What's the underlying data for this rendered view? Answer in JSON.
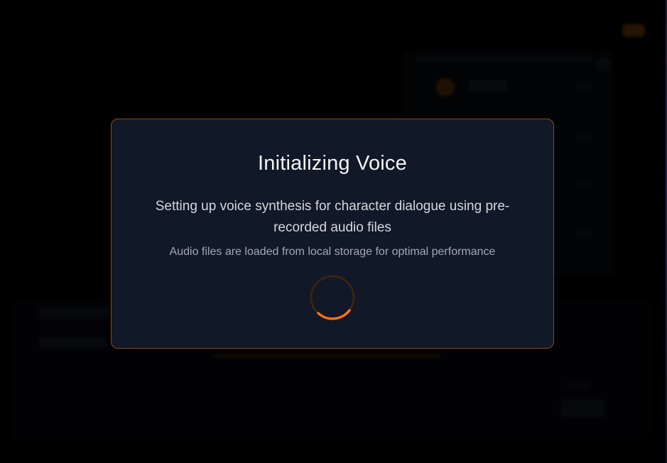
{
  "modal": {
    "title": "Initializing Voice",
    "description": "Setting up voice synthesis for character dialogue using pre-recorded audio files",
    "note": "Audio files are loaded from local storage for optimal performance",
    "spinner_icon": "loading-spinner-icon"
  },
  "colors": {
    "accent": "#f97316",
    "modal_background": "#111827",
    "modal_border": "#8a4a14",
    "page_background": "#000000"
  }
}
